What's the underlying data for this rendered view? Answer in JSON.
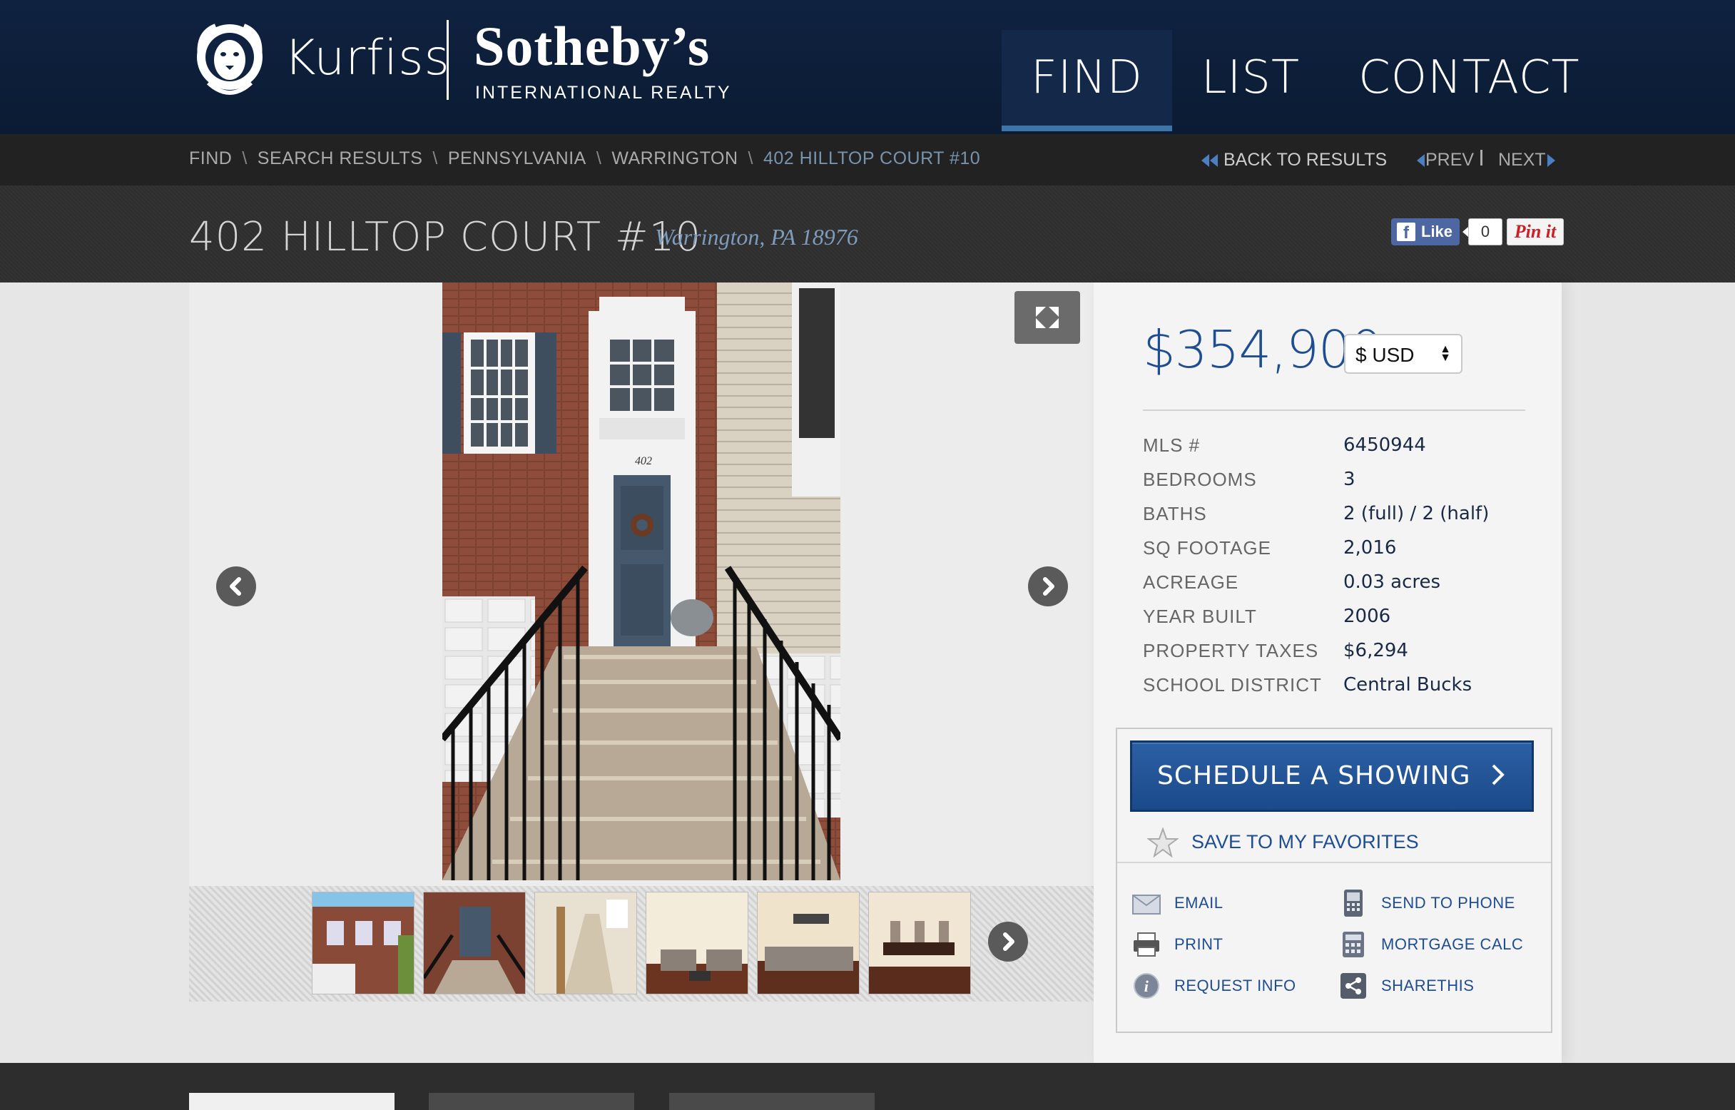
{
  "brand": {
    "name1": "Kurfiss",
    "name2": "Sotheby’s",
    "tagline": "INTERNATIONAL REALTY"
  },
  "nav": [
    {
      "label": "FIND",
      "active": true
    },
    {
      "label": "LIST",
      "active": false
    },
    {
      "label": "CONTACT",
      "active": false
    }
  ],
  "breadcrumb": {
    "items": [
      "FIND",
      "SEARCH RESULTS",
      "PENNSYLVANIA",
      "WARRINGTON"
    ],
    "current": "402 HILLTOP COURT #10",
    "separator": "\\"
  },
  "pager": {
    "back": "BACK TO RESULTS",
    "prev": "PREV",
    "next": "NEXT"
  },
  "listing": {
    "title": "402 HILLTOP COURT #10",
    "location": "Warrington, PA 18976",
    "price": "$354,900",
    "currency": "$ USD",
    "facts": [
      {
        "label": "MLS #",
        "value": "6450944"
      },
      {
        "label": "BEDROOMS",
        "value": "3"
      },
      {
        "label": "BATHS",
        "value": "2 (full) / 2 (half)"
      },
      {
        "label": "SQ FOOTAGE",
        "value": "2,016"
      },
      {
        "label": "ACREAGE",
        "value": "0.03 acres"
      },
      {
        "label": "YEAR BUILT",
        "value": "2006"
      },
      {
        "label": "PROPERTY TAXES",
        "value": "$6,294"
      },
      {
        "label": "SCHOOL DISTRICT",
        "value": "Central Bucks"
      }
    ]
  },
  "social": {
    "like": "Like",
    "like_count": "0",
    "pin": "Pin it"
  },
  "actions": {
    "schedule": "SCHEDULE A SHOWING",
    "save": "SAVE TO MY FAVORITES",
    "email": "EMAIL",
    "send_phone": "SEND TO PHONE",
    "print": "PRINT",
    "mortgage": "MORTGAGE CALC",
    "request": "REQUEST INFO",
    "share": "SHARETHIS"
  },
  "photo": {
    "house_number": "402"
  },
  "colors": {
    "header_bg": "#0f2240",
    "accent_blue": "#1f4d92",
    "nav_active_underline": "#3e74a8",
    "button_blue": "#2b5fa4"
  },
  "icons": {
    "lion_logo": "lion-logo",
    "expand": "expand-icon",
    "prev": "chevron-left-icon",
    "next": "chevron-right-icon",
    "star": "star-icon",
    "email": "envelope-icon",
    "phone": "phone-icon",
    "print": "printer-icon",
    "calc": "calculator-icon",
    "info": "info-icon",
    "share": "share-icon"
  }
}
